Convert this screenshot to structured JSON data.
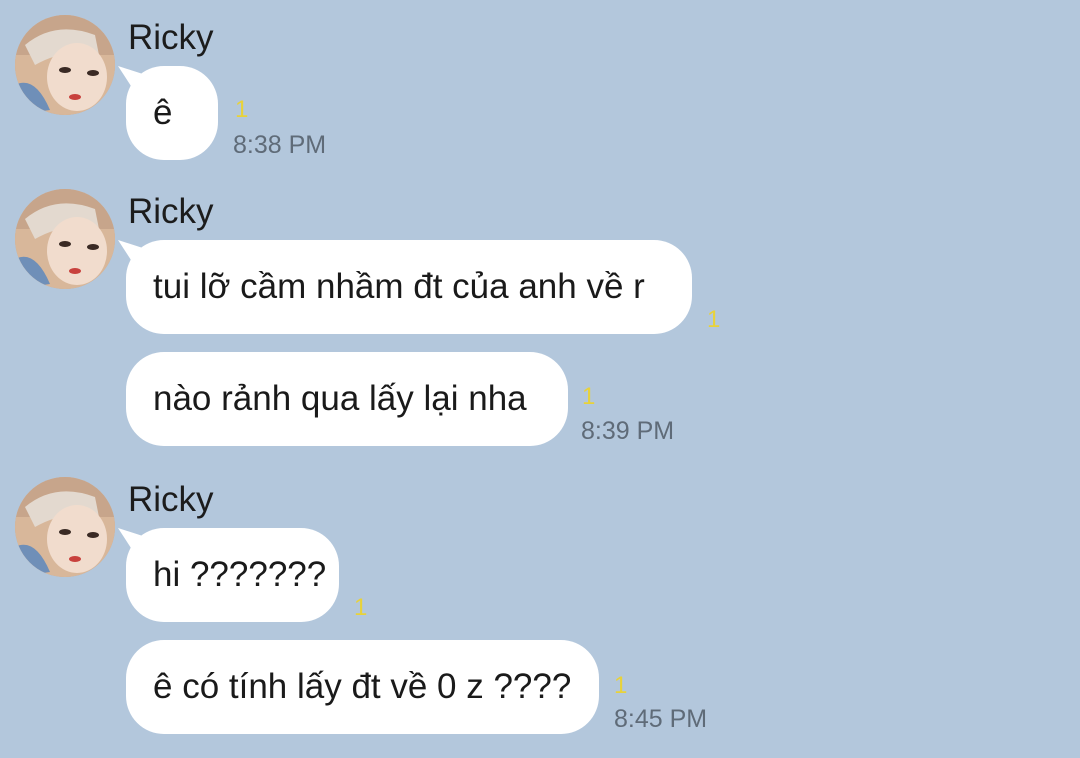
{
  "groups": [
    {
      "sender": "Ricky",
      "messages": [
        {
          "text": "ê",
          "read": "1",
          "time": "8:38 PM"
        }
      ]
    },
    {
      "sender": "Ricky",
      "messages": [
        {
          "text": "tui lỡ cầm nhầm đt của anh về r",
          "read": "1",
          "time": ""
        },
        {
          "text": "nào rảnh qua lấy lại nha",
          "read": "1",
          "time": "8:39 PM"
        }
      ]
    },
    {
      "sender": "Ricky",
      "messages": [
        {
          "text": "hi ???????",
          "read": "1",
          "time": ""
        },
        {
          "text": "ê có tính lấy đt về 0 z ????",
          "read": "1",
          "time": "8:45 PM"
        }
      ]
    }
  ],
  "colors": {
    "background": "#b3c7dc",
    "bubble": "#ffffff",
    "read_count": "#e8d23a",
    "timestamp": "#5f6b78"
  },
  "icons": {
    "avatar": "profile-photo"
  }
}
